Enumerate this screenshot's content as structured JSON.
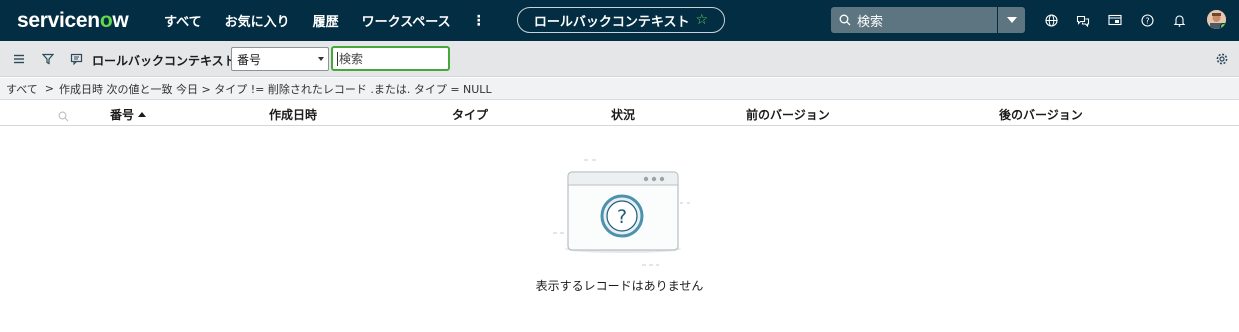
{
  "topnav": {
    "logo_prefix": "servicen",
    "logo_o": "o",
    "logo_suffix": "w",
    "menu": [
      "すべて",
      "お気に入り",
      "履歴",
      "ワークスペース"
    ],
    "more": "⋮",
    "context_title": "ロールバックコンテキスト",
    "search_label": "検索",
    "icons": [
      "globe-icon",
      "chat-icon",
      "screen-icon",
      "help-icon",
      "bell-icon"
    ],
    "brand_color": "#032d42",
    "accent_color": "#62d84e"
  },
  "listbar": {
    "title": "ロールバックコンテキスト",
    "field_select": "番号",
    "search_placeholder": "検索"
  },
  "breadcrumb": {
    "root": "すべて",
    "separator": ">",
    "condition": "作成日時 次の値と一致 今日 > タイプ != 削除されたレコード .または. タイプ = NULL"
  },
  "columns": [
    "番号",
    "作成日時",
    "タイプ",
    "状況",
    "前のバージョン",
    "後のバージョン"
  ],
  "empty": {
    "message": "表示するレコードはありません"
  }
}
